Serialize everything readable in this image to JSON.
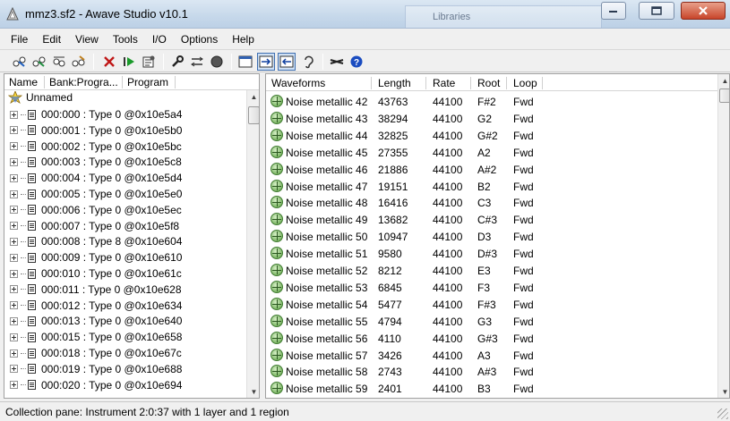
{
  "window": {
    "title": "mmz3.sf2 - Awave Studio v10.1",
    "background_window_label": "Libraries"
  },
  "menu": [
    "File",
    "Edit",
    "View",
    "Tools",
    "I/O",
    "Options",
    "Help"
  ],
  "toolbar": {
    "icons": [
      "import-icon",
      "export-icon",
      "convert-icon",
      "batch-icon",
      "delete-icon",
      "play-icon",
      "properties-icon",
      "tools-icon",
      "compare-icon",
      "record-icon",
      "view-icon",
      "expand-icon",
      "collapse-icon",
      "ear-icon",
      "cut-icon",
      "help-icon"
    ]
  },
  "collection": {
    "columns": [
      "Name",
      "Bank:Progra...",
      "Program"
    ],
    "root": "Unnamed",
    "items": [
      "000:000 : Type 0 @0x10e5a4",
      "000:001 : Type 0 @0x10e5b0",
      "000:002 : Type 0 @0x10e5bc",
      "000:003 : Type 0 @0x10e5c8",
      "000:004 : Type 0 @0x10e5d4",
      "000:005 : Type 0 @0x10e5e0",
      "000:006 : Type 0 @0x10e5ec",
      "000:007 : Type 0 @0x10e5f8",
      "000:008 : Type 8 @0x10e604",
      "000:009 : Type 0 @0x10e610",
      "000:010 : Type 0 @0x10e61c",
      "000:011 : Type 0 @0x10e628",
      "000:012 : Type 0 @0x10e634",
      "000:013 : Type 0 @0x10e640",
      "000:015 : Type 0 @0x10e658",
      "000:018 : Type 0 @0x10e67c",
      "000:019 : Type 0 @0x10e688",
      "000:020 : Type 0 @0x10e694"
    ]
  },
  "waveforms": {
    "columns": [
      "Waveforms",
      "Length",
      "Rate",
      "Root",
      "Loop"
    ],
    "rows": [
      [
        "Noise metallic 42",
        "43763",
        "44100",
        "F#2",
        "Fwd"
      ],
      [
        "Noise metallic 43",
        "38294",
        "44100",
        "G2",
        "Fwd"
      ],
      [
        "Noise metallic 44",
        "32825",
        "44100",
        "G#2",
        "Fwd"
      ],
      [
        "Noise metallic 45",
        "27355",
        "44100",
        "A2",
        "Fwd"
      ],
      [
        "Noise metallic 46",
        "21886",
        "44100",
        "A#2",
        "Fwd"
      ],
      [
        "Noise metallic 47",
        "19151",
        "44100",
        "B2",
        "Fwd"
      ],
      [
        "Noise metallic 48",
        "16416",
        "44100",
        "C3",
        "Fwd"
      ],
      [
        "Noise metallic 49",
        "13682",
        "44100",
        "C#3",
        "Fwd"
      ],
      [
        "Noise metallic 50",
        "10947",
        "44100",
        "D3",
        "Fwd"
      ],
      [
        "Noise metallic 51",
        "9580",
        "44100",
        "D#3",
        "Fwd"
      ],
      [
        "Noise metallic 52",
        "8212",
        "44100",
        "E3",
        "Fwd"
      ],
      [
        "Noise metallic 53",
        "6845",
        "44100",
        "F3",
        "Fwd"
      ],
      [
        "Noise metallic 54",
        "5477",
        "44100",
        "F#3",
        "Fwd"
      ],
      [
        "Noise metallic 55",
        "4794",
        "44100",
        "G3",
        "Fwd"
      ],
      [
        "Noise metallic 56",
        "4110",
        "44100",
        "G#3",
        "Fwd"
      ],
      [
        "Noise metallic 57",
        "3426",
        "44100",
        "A3",
        "Fwd"
      ],
      [
        "Noise metallic 58",
        "2743",
        "44100",
        "A#3",
        "Fwd"
      ],
      [
        "Noise metallic 59",
        "2401",
        "44100",
        "B3",
        "Fwd"
      ]
    ]
  },
  "status": "Collection pane: Instrument 2:0:37 with 1 layer and 1 region"
}
